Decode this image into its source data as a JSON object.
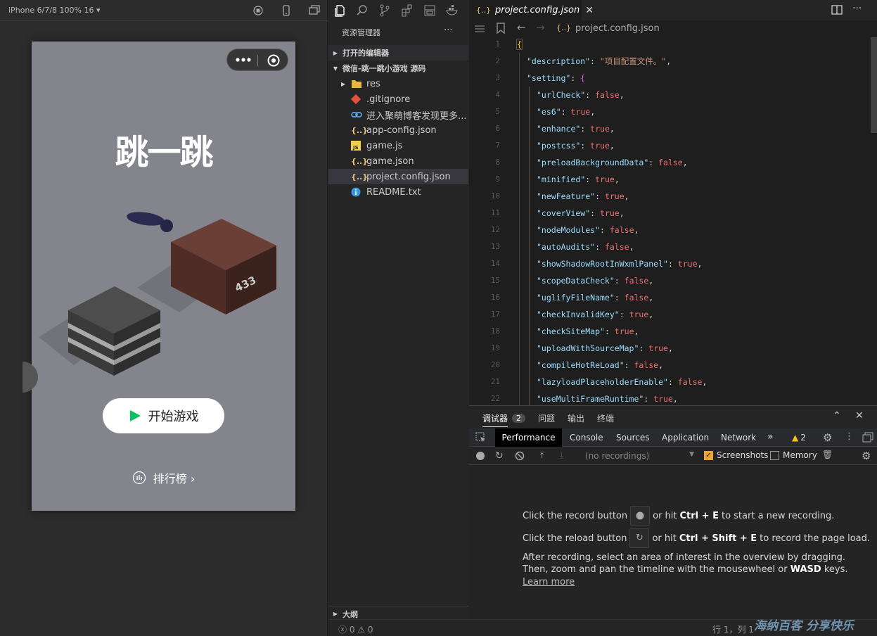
{
  "simulator": {
    "device_label": "iPhone 6/7/8 100% 16 ▾",
    "game_title": "跳一跳",
    "score_on_box": "433",
    "start_button": "开始游戏",
    "leaderboard": "排行榜 ›"
  },
  "explorer": {
    "title": "资源管理器",
    "more": "···",
    "open_editors": "打开的编辑器",
    "project": "微信-跳一跳小游戏 源码",
    "files": [
      {
        "name": "res",
        "icon": "folder-icon"
      },
      {
        "name": ".gitignore",
        "icon": "git-icon"
      },
      {
        "name": "进入聚萌博客发现更多...",
        "icon": "link-icon"
      },
      {
        "name": "app-config.json",
        "icon": "json-icon"
      },
      {
        "name": "game.js",
        "icon": "js-icon"
      },
      {
        "name": "game.json",
        "icon": "json-icon"
      },
      {
        "name": "project.config.json",
        "icon": "json-icon"
      },
      {
        "name": "README.txt",
        "icon": "info-icon"
      }
    ],
    "outline": "大纲",
    "problems": "ⓧ 0 ⚠ 0"
  },
  "editor": {
    "tab_label": "project.config.json",
    "breadcrumb": "project.config.json",
    "json_icon": "{..}",
    "lines": [
      {
        "n": "1",
        "k": "",
        "v": "",
        "t": "open"
      },
      {
        "n": "2",
        "k": "\"description\"",
        "v": "\"项目配置文件。\"",
        "t": "s"
      },
      {
        "n": "3",
        "k": "\"setting\"",
        "v": "{",
        "t": "obj"
      },
      {
        "n": "4",
        "k": "\"urlCheck\"",
        "v": "false",
        "t": "b"
      },
      {
        "n": "5",
        "k": "\"es6\"",
        "v": "true",
        "t": "b"
      },
      {
        "n": "6",
        "k": "\"enhance\"",
        "v": "true",
        "t": "b"
      },
      {
        "n": "7",
        "k": "\"postcss\"",
        "v": "true",
        "t": "b"
      },
      {
        "n": "8",
        "k": "\"preloadBackgroundData\"",
        "v": "false",
        "t": "b"
      },
      {
        "n": "9",
        "k": "\"minified\"",
        "v": "true",
        "t": "b"
      },
      {
        "n": "10",
        "k": "\"newFeature\"",
        "v": "true",
        "t": "b"
      },
      {
        "n": "11",
        "k": "\"coverView\"",
        "v": "true",
        "t": "b"
      },
      {
        "n": "12",
        "k": "\"nodeModules\"",
        "v": "false",
        "t": "b"
      },
      {
        "n": "13",
        "k": "\"autoAudits\"",
        "v": "false",
        "t": "b"
      },
      {
        "n": "14",
        "k": "\"showShadowRootInWxmlPanel\"",
        "v": "true",
        "t": "b"
      },
      {
        "n": "15",
        "k": "\"scopeDataCheck\"",
        "v": "false",
        "t": "b"
      },
      {
        "n": "16",
        "k": "\"uglifyFileName\"",
        "v": "false",
        "t": "b"
      },
      {
        "n": "17",
        "k": "\"checkInvalidKey\"",
        "v": "true",
        "t": "b"
      },
      {
        "n": "18",
        "k": "\"checkSiteMap\"",
        "v": "true",
        "t": "b"
      },
      {
        "n": "19",
        "k": "\"uploadWithSourceMap\"",
        "v": "true",
        "t": "b"
      },
      {
        "n": "20",
        "k": "\"compileHotReLoad\"",
        "v": "false",
        "t": "b"
      },
      {
        "n": "21",
        "k": "\"lazyloadPlaceholderEnable\"",
        "v": "false",
        "t": "b"
      },
      {
        "n": "22",
        "k": "\"useMultiFrameRuntime\"",
        "v": "true",
        "t": "b"
      }
    ]
  },
  "devtools": {
    "panel_tabs": [
      "调试器",
      "问题",
      "输出",
      "终端"
    ],
    "debugger_badge": "2",
    "tabs": [
      "Performance",
      "Console",
      "Sources",
      "Application",
      "Network"
    ],
    "more_tabs": "»",
    "warn_count": "2",
    "recordings": "(no recordings)",
    "screenshots_label": "Screenshots",
    "screenshots_checked": true,
    "memory_label": "Memory",
    "memory_checked": false,
    "record_text_1": "Click the record button",
    "record_text_2": "or hit",
    "record_key": "Ctrl + E",
    "record_text_3": "to start a new recording.",
    "reload_text_1": "Click the reload button",
    "reload_key": "Ctrl + Shift + E",
    "reload_text_3": "to record the page load.",
    "after_1": "After recording, select an area of interest in the overview by dragging.",
    "after_2a": "Then, zoom and pan the timeline with the mousewheel or",
    "after_key": "WASD",
    "after_2b": "keys.",
    "learn_more": "Learn more"
  },
  "status": {
    "position": "行 1，列 1",
    "watermark": "海纳百客 分享快乐"
  },
  "colors": {
    "accent_green": "#07c160",
    "key_blue": "#9cdcfe",
    "string_orange": "#ce9178",
    "bool_red": "#f07070"
  }
}
